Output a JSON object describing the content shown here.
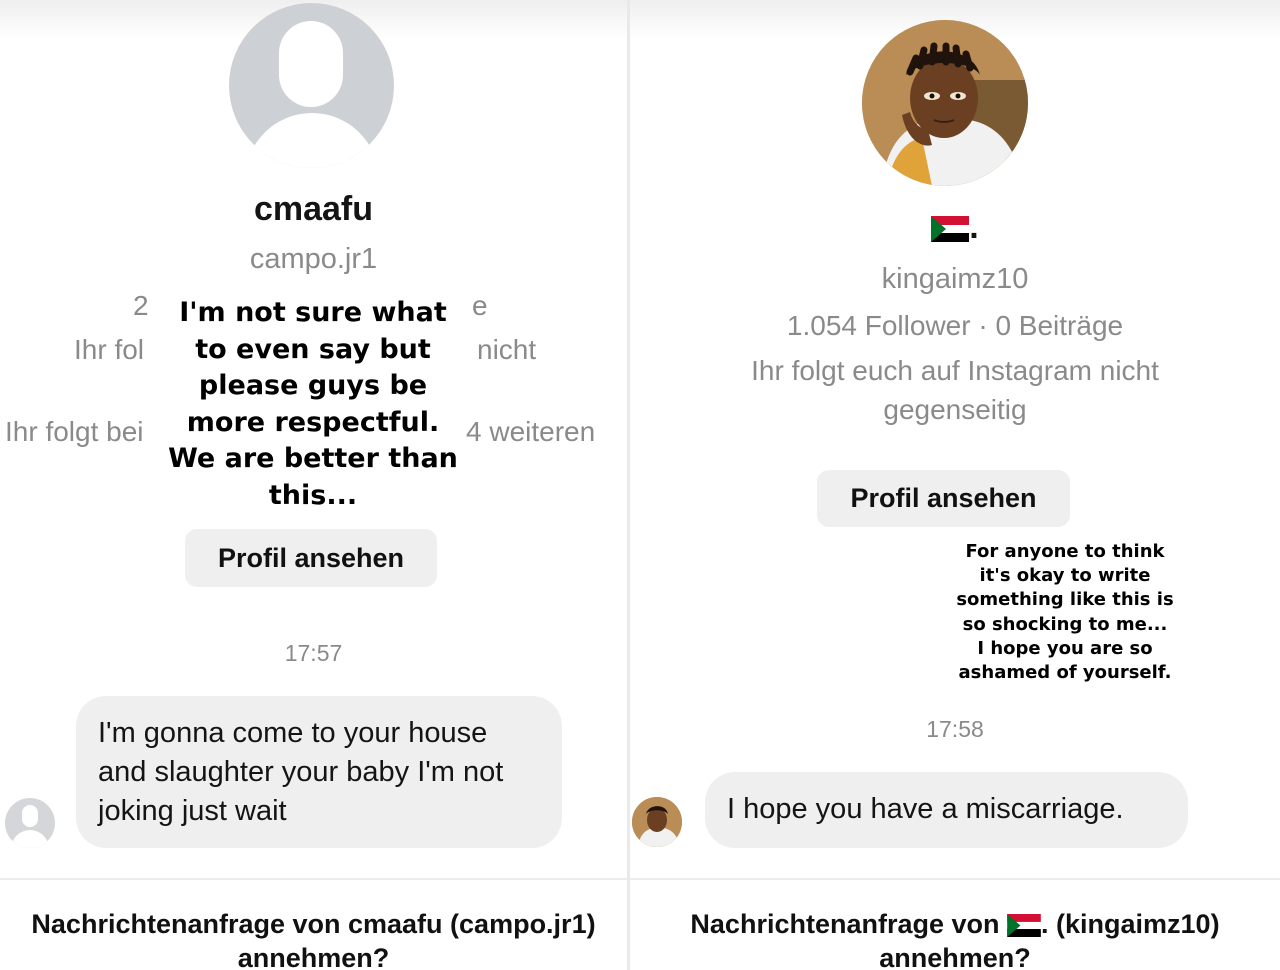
{
  "left": {
    "display_name": "cmaafu",
    "username": "campo.jr1",
    "partial_line_1_left": "2",
    "partial_line_1_right": "e",
    "partial_line_2_left": "Ihr fol",
    "partial_line_2_right": "nicht",
    "partial_line_3_left": "Ihr folgt bei",
    "partial_line_3_right": "4 weiteren",
    "overlay_caption": "I'm not sure what to even say but please guys be more respectful. We are better than this...",
    "view_profile_label": "Profil ansehen",
    "timestamp": "17:57",
    "message": "I'm gonna come to your house and slaughter your baby I'm not joking just wait",
    "request_line1": "Nachrichtenanfrage von cmaafu (campo.jr1)",
    "request_line2": "annehmen?"
  },
  "right": {
    "display_name": ".",
    "username": "kingaimz10",
    "stats": "1.054 Follower · 0 Beiträge",
    "follow_note_line1": "Ihr folgt euch auf Instagram nicht",
    "follow_note_line2": "gegenseitig",
    "view_profile_label": "Profil ansehen",
    "overlay_caption_lines": [
      "For anyone to think",
      "it's okay to write",
      "something like this is",
      "so shocking to me...",
      "I hope you are so",
      "ashamed of yourself."
    ],
    "timestamp": "17:58",
    "message": "I hope you have a miscarriage.",
    "request_prefix": "Nachrichtenanfrage von",
    "request_suffix": ". (kingaimz10)",
    "request_line2": "annehmen?"
  },
  "icons": {
    "default_avatar": "person-silhouette-icon",
    "flag": "sudan-flag-icon"
  },
  "colors": {
    "bubble_bg": "#efefef",
    "secondary_text": "#8a8a8a",
    "button_bg": "#efefef"
  }
}
